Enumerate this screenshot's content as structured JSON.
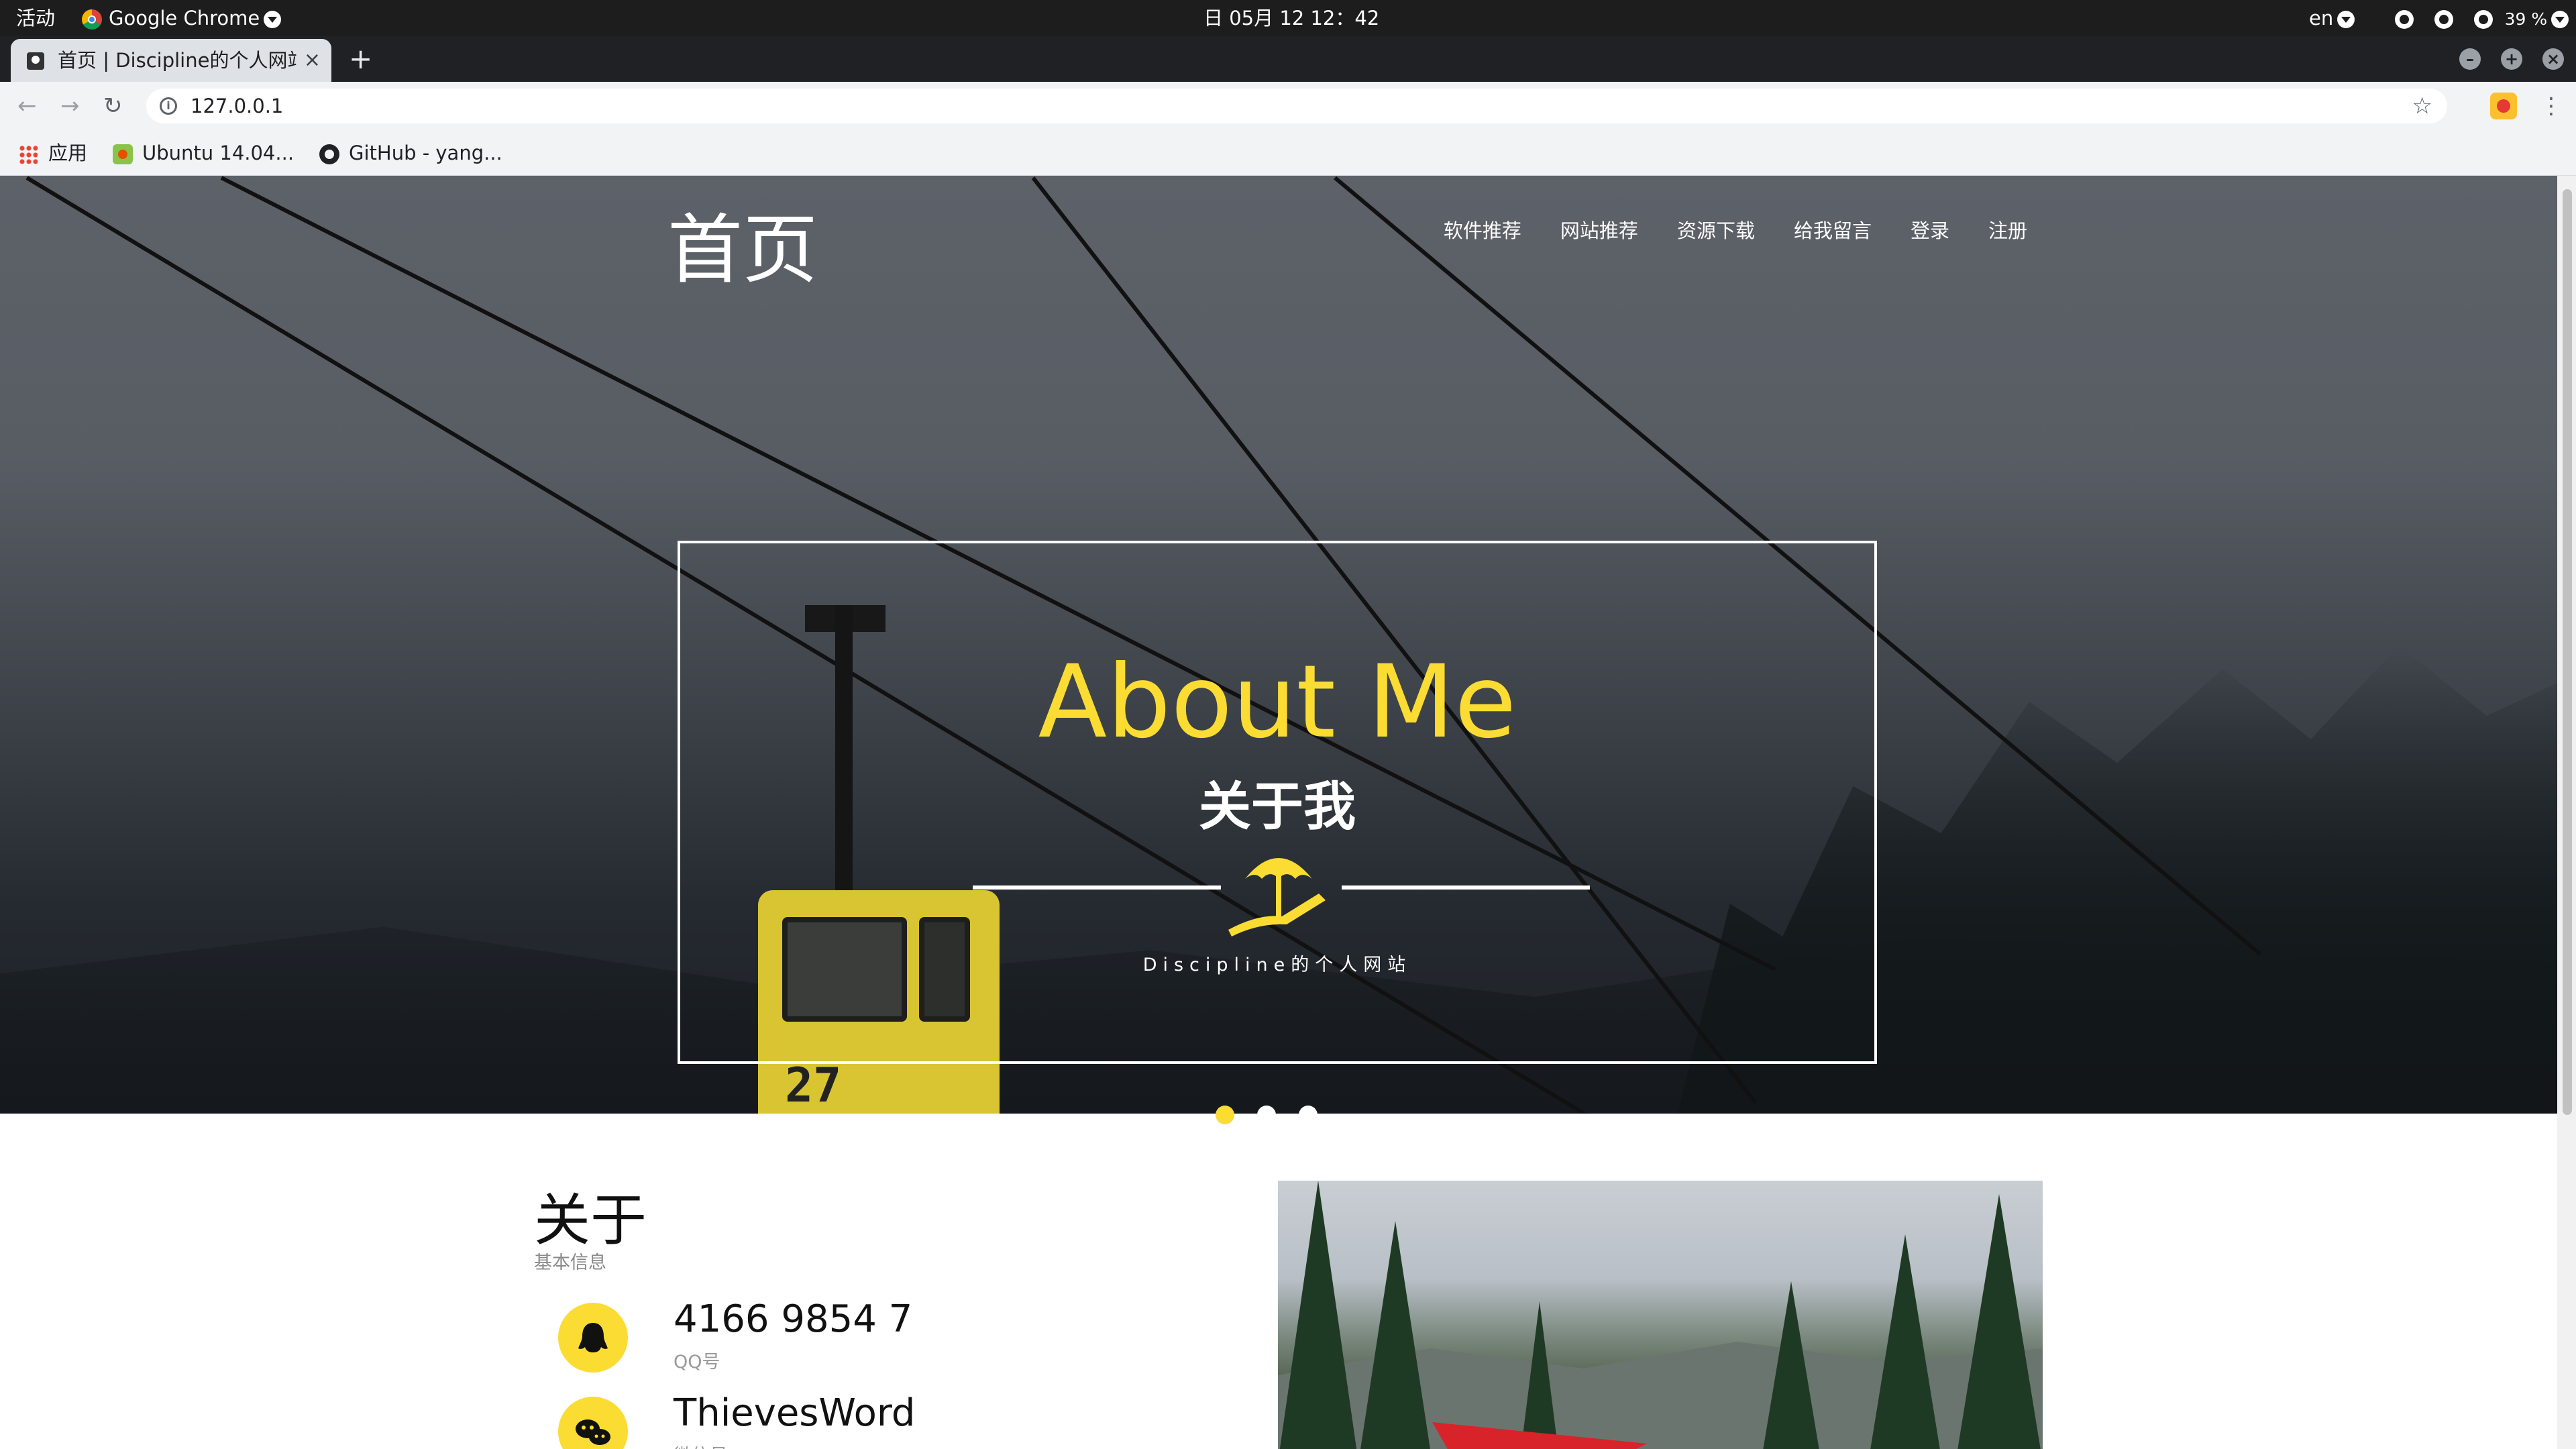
{
  "system_bar": {
    "activities": "活动",
    "app_name": "Google Chrome",
    "clock": "日 05月 12  12：42",
    "input_method": "en",
    "battery": "39 %"
  },
  "browser": {
    "tab_title": "首页 | Discipline的个人网站",
    "tab_close": "×",
    "new_tab": "+",
    "url": "127.0.0.1",
    "bookmarks": [
      "应用",
      "Ubuntu 14.04...",
      "GitHub - yang..."
    ]
  },
  "page": {
    "brand": "首页",
    "nav": [
      "软件推荐",
      "网站推荐",
      "资源下载",
      "给我留言",
      "登录",
      "注册"
    ],
    "hero": {
      "title": "About Me",
      "subtitle": "关于我",
      "tagline": "Discipline的个人网站",
      "gondola_number": "27",
      "slide_count": 3,
      "active_slide": 1
    },
    "about": {
      "title": "关于",
      "subtitle": "基本信息",
      "items": [
        {
          "icon": "qq-icon",
          "value": "4166 9854 7",
          "label": "QQ号"
        },
        {
          "icon": "wechat-icon",
          "value": "ThievesWord",
          "label": "微信号"
        }
      ]
    }
  },
  "colors": {
    "accent_yellow": "#fbdc33",
    "topbar": "#1d1d1d",
    "tabstrip": "#202124",
    "toolbar": "#f1f3f4"
  }
}
